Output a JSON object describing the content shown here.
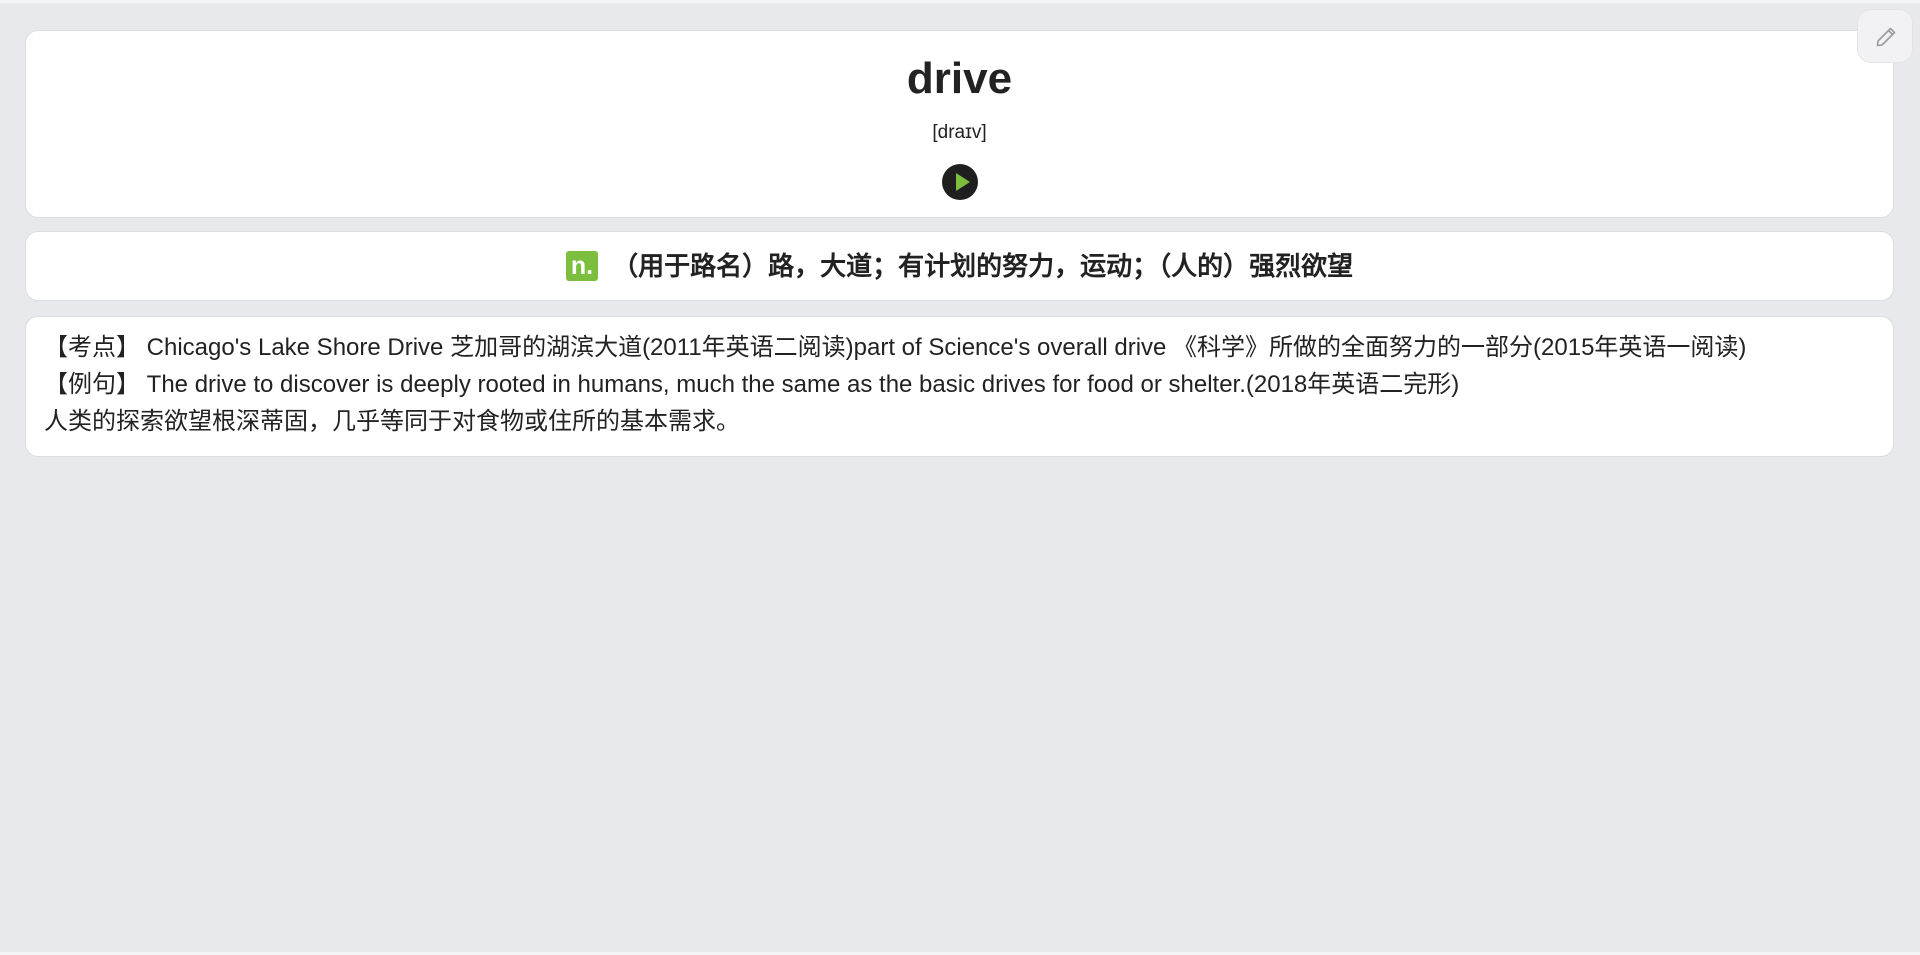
{
  "word": {
    "title": "drive",
    "phonetic": "[draɪv]",
    "play_icon": "play-circle-icon"
  },
  "definition": {
    "pos": "n.",
    "text": "（用于路名）路，大道；有计划的努力，运动；（人的）强烈欲望",
    "pos_color": "#7cbf3f"
  },
  "examples": {
    "kaodian_line": "【考点】 Chicago's Lake Shore Drive 芝加哥的湖滨大道(2011年英语二阅读)part of Science's overall drive 《科学》所做的全面努力的一部分(2015年英语一阅读)",
    "liju_line": "【例句】 The drive to discover is deeply rooted in humans, much the same as the basic drives for food or shelter.(2018年英语二完形)",
    "translation": "人类的探索欲望根深蒂固，几乎等同于对食物或住所的基本需求。"
  },
  "toolbar": {
    "edit_icon": "pencil-icon"
  }
}
